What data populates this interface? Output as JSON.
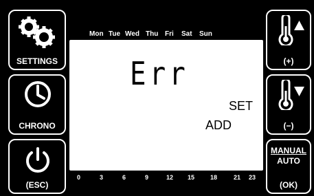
{
  "left_buttons": {
    "settings_label": "SETTINGS",
    "chrono_label": "CHRONO",
    "esc_label": "(ESC)"
  },
  "right_buttons": {
    "plus_label": "(+)",
    "minus_label": "(−)",
    "manual_label": "MANUAL",
    "auto_label": "AUTO",
    "ok_label": "(OK)"
  },
  "days": [
    "Mon",
    "Tue",
    "Wed",
    "Thu",
    "Fri",
    "Sat",
    "Sun"
  ],
  "hours": [
    "0",
    "3",
    "6",
    "9",
    "12",
    "15",
    "18",
    "21",
    "23"
  ],
  "display": {
    "main": "Err",
    "set": "SET",
    "add": "ADD"
  },
  "icons": {
    "settings": "gears-icon",
    "chrono": "clock-icon",
    "esc": "power-icon",
    "plus": "thermometer-up-icon",
    "minus": "thermometer-down-icon"
  }
}
